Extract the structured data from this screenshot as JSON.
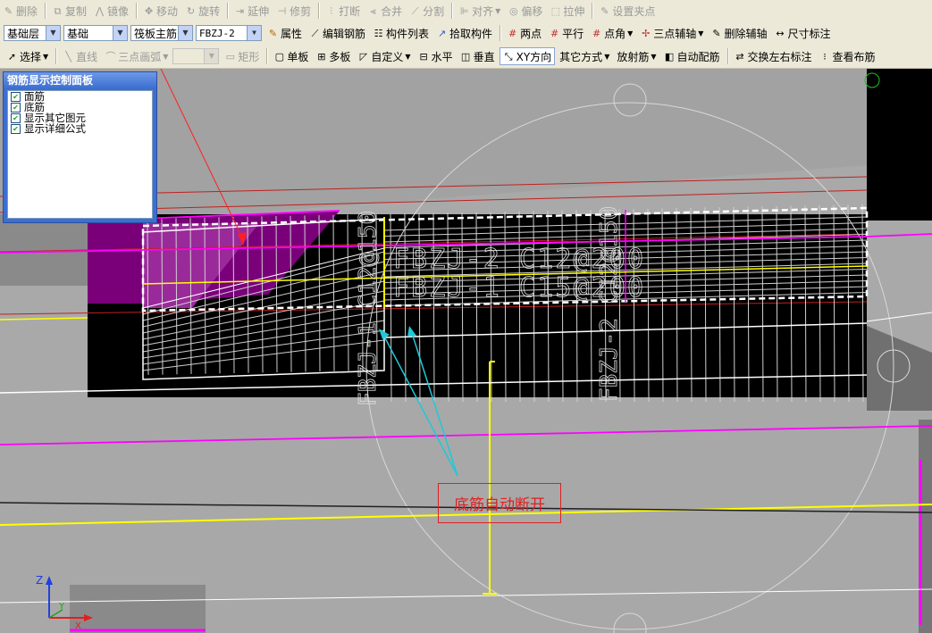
{
  "toolbar1": {
    "delete": "删除",
    "copy": "复制",
    "mirror": "镜像",
    "move": "移动",
    "rotate": "旋转",
    "extend": "延伸",
    "trim": "修剪",
    "break": "打断",
    "merge": "合并",
    "split": "分割",
    "align": "对齐",
    "offset": "偏移",
    "stretch": "拉伸",
    "set_grip": "设置夹点"
  },
  "toolbar2": {
    "floor": "基础层",
    "category": "基础",
    "component_type": "筏板主筋",
    "component_name": "FBZJ-2",
    "properties": "属性",
    "edit_rebar": "编辑钢筋",
    "component_list": "构件列表",
    "pick_component": "拾取构件",
    "two_points": "两点",
    "parallel": "平行",
    "point_angle": "点角",
    "three_point_axis": "三点辅轴",
    "delete_axis": "删除辅轴",
    "dimension": "尺寸标注"
  },
  "toolbar3": {
    "select": "选择",
    "line": "直线",
    "three_point_arc": "三点画弧",
    "rect": "矩形",
    "single_slab": "单板",
    "multi_slab": "多板",
    "custom": "自定义",
    "horizontal": "水平",
    "vertical": "垂直",
    "xy_direction": "XY方向",
    "other_method": "其它方式",
    "radial_rebar": "放射筋",
    "auto_rebar": "自动配筋",
    "swap_labels": "交换左右标注",
    "view_layout": "查看布筋"
  },
  "panel": {
    "title": "钢筋显示控制面板",
    "options": [
      {
        "label": "面筋",
        "checked": true
      },
      {
        "label": "底筋",
        "checked": true
      },
      {
        "label": "显示其它图元",
        "checked": true
      },
      {
        "label": "显示详细公式",
        "checked": true
      }
    ]
  },
  "annotation": {
    "text": "底筋自动断开"
  },
  "labels": {
    "rebar_vertical_1": "FBZJ-1 C12@150",
    "rebar_vertical_2": "FBZJ-2 C12@150",
    "rebar_horizontal_1": "FBZJ-2 C12@200",
    "rebar_horizontal_2": "FBZJ-1 C15@200"
  },
  "axis": {
    "z": "Z",
    "y": "Y",
    "x": "X"
  },
  "colors": {
    "magenta": "#ff00ff",
    "yellow": "#ffff00",
    "red": "#cc2020",
    "cyan": "#20c8d8",
    "white": "#ffffff"
  }
}
